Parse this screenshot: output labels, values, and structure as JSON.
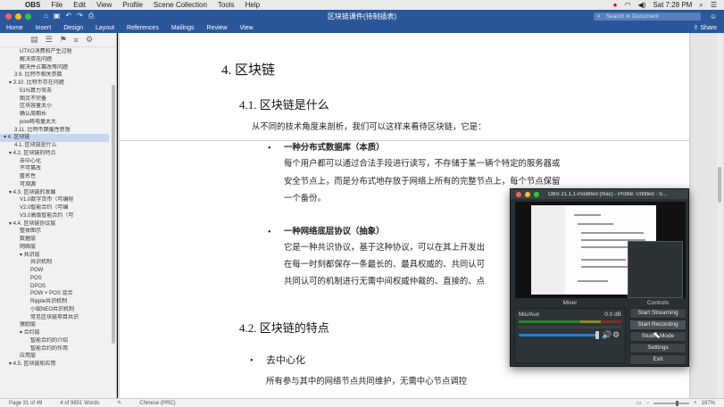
{
  "menubar": {
    "app": "OBS",
    "items": [
      "File",
      "Edit",
      "View",
      "Profile",
      "Scene Collection",
      "Tools",
      "Help"
    ],
    "clock": "Sat 7:28 PM"
  },
  "titlebar": {
    "title": "区块链课件(待制插表)",
    "search_placeholder": "Search in Document",
    "colors": {
      "close": "#ff5f57",
      "min": "#febc2e",
      "max": "#28c840"
    }
  },
  "ribbon": {
    "tabs": [
      "Home",
      "Insert",
      "Design",
      "Layout",
      "References",
      "Mailings",
      "Review",
      "View"
    ],
    "share": "Share"
  },
  "nav": {
    "items": [
      {
        "text": "UTXO消费和产生过程",
        "indent": 3
      },
      {
        "text": "解决双花问题",
        "indent": 3
      },
      {
        "text": "解决并占篡改等问题",
        "indent": 3
      },
      {
        "text": "3.9. 比特币相关参数",
        "indent": 2
      },
      {
        "text": "▾ 3.10. 比特币存在问题",
        "indent": 1
      },
      {
        "text": "51%算力攻击",
        "indent": 3
      },
      {
        "text": "图灵不完备",
        "indent": 3
      },
      {
        "text": "区块容量太小",
        "indent": 3
      },
      {
        "text": "确认周期长",
        "indent": 3
      },
      {
        "text": "pow耗电量太大",
        "indent": 3
      },
      {
        "text": "3.11. 比特币颠覆性思想",
        "indent": 2
      },
      {
        "text": "▾ 4. 区块链",
        "indent": 0,
        "selected": true
      },
      {
        "text": "4.1. 区块链是什么",
        "indent": 2
      },
      {
        "text": "▾ 4.2. 区块链的特点",
        "indent": 1
      },
      {
        "text": "去中心化",
        "indent": 3
      },
      {
        "text": "不可篡改",
        "indent": 3
      },
      {
        "text": "匿名性",
        "indent": 3
      },
      {
        "text": "可溯源",
        "indent": 3
      },
      {
        "text": "▾ 4.3. 区块链的发展",
        "indent": 1
      },
      {
        "text": "V1.0数字货币（可编程",
        "indent": 3
      },
      {
        "text": "V2.0智能合约（可编",
        "indent": 3
      },
      {
        "text": "V3.0高级智能合约（可",
        "indent": 3
      },
      {
        "text": "▾ 4.4. 区块链协议层",
        "indent": 1
      },
      {
        "text": "整体图示",
        "indent": 3
      },
      {
        "text": "数据层",
        "indent": 3
      },
      {
        "text": "网络层",
        "indent": 3
      },
      {
        "text": "▾ 共识层",
        "indent": 3
      },
      {
        "text": "共识机制",
        "indent": 5
      },
      {
        "text": "POW",
        "indent": 5
      },
      {
        "text": "POS",
        "indent": 5
      },
      {
        "text": "DPOS",
        "indent": 5
      },
      {
        "text": "POW + POS 混合",
        "indent": 5
      },
      {
        "text": "Ripple共识机制",
        "indent": 5
      },
      {
        "text": "小蚁NEO共识机制",
        "indent": 5
      },
      {
        "text": "常见区块链项目共识",
        "indent": 5
      },
      {
        "text": "激励层",
        "indent": 3
      },
      {
        "text": "▾ 合约层",
        "indent": 3
      },
      {
        "text": "智能合约的介绍",
        "indent": 5
      },
      {
        "text": "智能合约的作用",
        "indent": 5
      },
      {
        "text": "应用层",
        "indent": 3
      },
      {
        "text": "▾ 4.5. 区块链和应用",
        "indent": 1
      }
    ]
  },
  "document": {
    "h1": "4.  区块链",
    "h2_1": "4.1. 区块链是什么",
    "intro": "从不同的技术角度来剖析，我们可以这样来看待区块链，它是：",
    "bullet1_title": "一种分布式数据库（本质）",
    "bullet1_lines": [
      "每个用户都可以通过合法手段进行读写，不存储于某一辆个特定的服务器或",
      "安全节点上，而是分布式地存放于网络上所有的完整节点上，每个节点保留",
      "一个备份。"
    ],
    "bullet2_title": "一种网络底层协议（抽象）",
    "bullet2_lines": [
      "它是一种共识协议，基于这种协议，可以在其上开发出",
      "在每一时刻都保存一条最长的、最具权威的、共同认可",
      "共同认可的机制进行无需中间权威仲裁的、直接的、点"
    ],
    "h2_2": "4.2. 区块链的特点",
    "bullet3_title": "去中心化",
    "bullet3_line": "所有参与其中的网络节点共同维护，无需中心节点调控"
  },
  "status": {
    "page": "Page 31 of 49",
    "words": "4 of 9851 Words",
    "language": "Chinese (PRC)",
    "zoom": "187%",
    "zoom_fraction": 0.62
  },
  "obs": {
    "title": "OBS 21.1.1-modified (mac) - Profile: Untitled - S...",
    "mixer_label": "Mixer",
    "controls_label": "Controls",
    "source": "Mic/Aux",
    "level": "0.0 dB",
    "volume_fraction": 0.9,
    "buttons": [
      "Start Streaming",
      "Start Recording",
      "Studio Mode",
      "Settings",
      "Exit"
    ]
  }
}
